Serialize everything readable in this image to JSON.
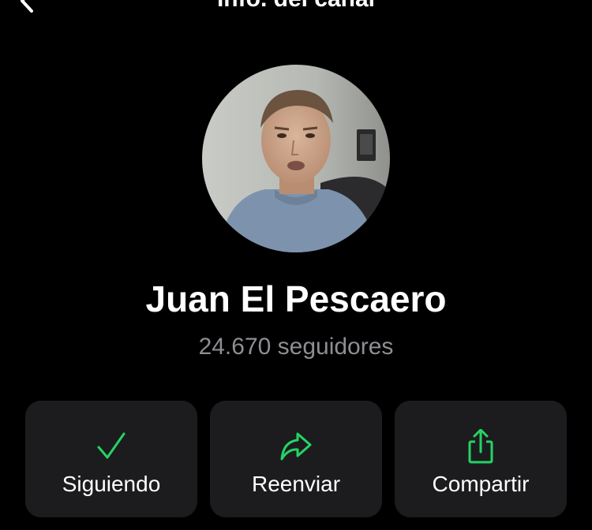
{
  "header": {
    "title": "Info. del canal",
    "back_icon": "chevron-left-icon"
  },
  "channel": {
    "name": "Juan El Pescaero",
    "followers": "24.670 seguidores",
    "avatar": "avatar-photo"
  },
  "actions": [
    {
      "label": "Siguiendo",
      "icon": "checkmark-icon"
    },
    {
      "label": "Reenviar",
      "icon": "forward-arrow-icon"
    },
    {
      "label": "Compartir",
      "icon": "share-icon"
    }
  ],
  "colors": {
    "background": "#000000",
    "card": "#1c1c1e",
    "accent": "#25d366",
    "secondary_text": "#8e8e93"
  }
}
